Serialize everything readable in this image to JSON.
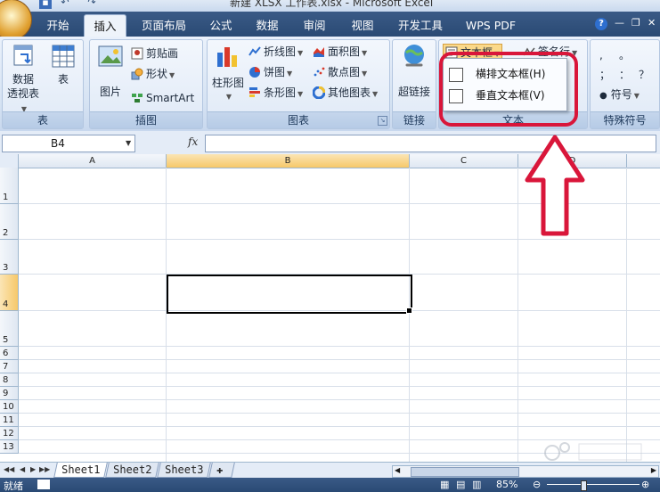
{
  "window": {
    "title": "新建 XLSX 工作表.xlsx - Microsoft Excel"
  },
  "tabs": [
    {
      "label": "开始"
    },
    {
      "label": "插入"
    },
    {
      "label": "页面布局"
    },
    {
      "label": "公式"
    },
    {
      "label": "数据"
    },
    {
      "label": "审阅"
    },
    {
      "label": "视图"
    },
    {
      "label": "开发工具"
    },
    {
      "label": "WPS PDF"
    }
  ],
  "ribbon": {
    "groups": {
      "tables": {
        "label": "表",
        "pivot_label_line1": "数据",
        "pivot_label_line2": "透视表",
        "table_label": "表"
      },
      "illustrations": {
        "label": "插图",
        "picture": "图片",
        "clipart": "剪贴画",
        "shapes": "形状",
        "smartart": "SmartArt"
      },
      "charts": {
        "label": "图表",
        "column": "柱形图",
        "line": "折线图",
        "pie": "饼图",
        "bar": "条形图",
        "area": "面积图",
        "scatter": "散点图",
        "other": "其他图表"
      },
      "links": {
        "label": "链接",
        "hyperlink": "超链接"
      },
      "text": {
        "label": "文本",
        "textbox": "文本框",
        "signature": "签名行"
      },
      "symbols": {
        "label": "特殊符号",
        "symbol": "符号",
        "glyphs": [
          ",",
          "。",
          "；",
          "：",
          "？"
        ]
      }
    }
  },
  "textbox_menu": {
    "items": [
      {
        "label": "横排文本框(H)"
      },
      {
        "label": "垂直文本框(V)"
      }
    ]
  },
  "formula_bar": {
    "name_box": "B4",
    "fx": "fx",
    "value": ""
  },
  "grid": {
    "columns": [
      "A",
      "B",
      "C",
      "D"
    ],
    "rows": [
      "1",
      "2",
      "3",
      "4",
      "5",
      "6",
      "7",
      "8",
      "9",
      "10",
      "11",
      "12",
      "13"
    ],
    "selected_cell": "B4"
  },
  "sheets": [
    {
      "label": "Sheet1",
      "active": true
    },
    {
      "label": "Sheet2",
      "active": false
    },
    {
      "label": "Sheet3",
      "active": false
    }
  ],
  "status": {
    "ready": "就绪",
    "zoom": "85%"
  },
  "colors": {
    "tab_bar": "#2f4f7c",
    "ribbon": "#dfe9f6",
    "highlight": "#d9163a",
    "selected_header": "#f6c86a"
  }
}
